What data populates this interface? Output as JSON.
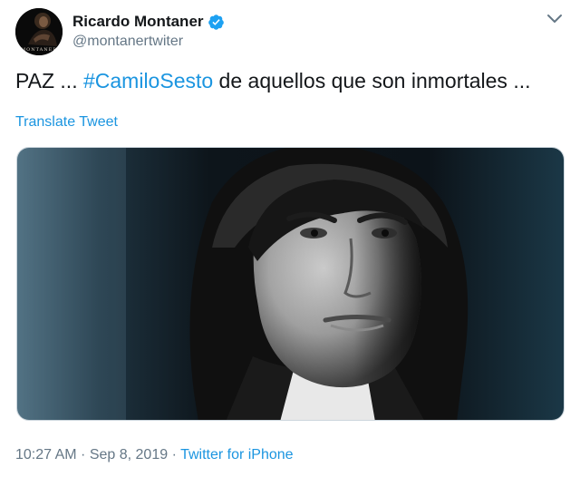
{
  "author": {
    "display_name": "Ricardo Montaner",
    "handle": "@montanertwiter",
    "avatar_text": "MONTANER",
    "verified_icon": "verified-badge-icon",
    "verified_color": "#1da1f2"
  },
  "menu_icon": "chevron-down-icon",
  "tweet": {
    "text_before": "PAZ ... ",
    "hashtag": "#CamiloSesto",
    "text_after": " de aquellos que son inmortales ..."
  },
  "translate_label": "Translate Tweet",
  "meta": {
    "time": "10:27 AM",
    "separator_1": " · ",
    "date": "Sep 8, 2019",
    "separator_2": " · ",
    "source": "Twitter for iPhone"
  },
  "colors": {
    "link": "#1b95e0",
    "secondary_text": "#657786",
    "primary_text": "#14171a"
  }
}
